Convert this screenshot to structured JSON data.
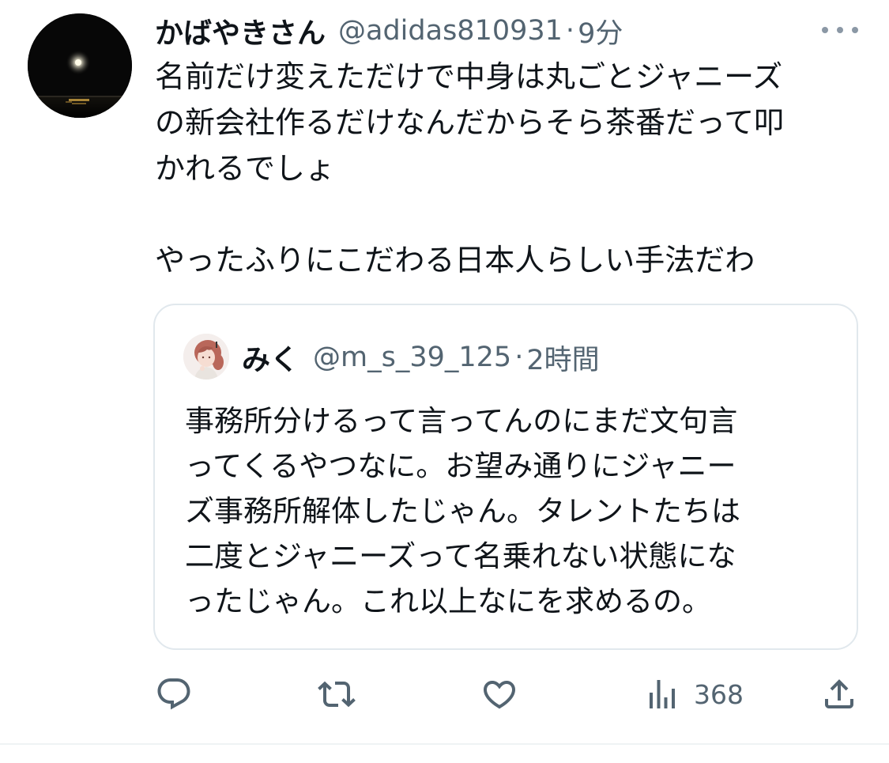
{
  "tweet": {
    "display_name": "かばやきさん",
    "handle": "@adidas810931",
    "separator": "·",
    "time": "9分",
    "avatar_icon": "moon-over-sea-avatar",
    "text_lines": [
      "名前だけ変えただけで中身は丸ごとジャニーズ",
      "の新会社作るだけなんだからそら茶番だって叩",
      "かれるでしょ",
      "",
      "やったふりにこだわる日本人らしい手法だわ"
    ]
  },
  "quoted_tweet": {
    "display_name": "みく",
    "handle": "@m_s_39_125",
    "separator": "·",
    "time": "2時間",
    "avatar_icon": "illustrated-girl-avatar",
    "text_lines": [
      "事務所分けるって言ってんのにまだ文句言",
      "ってくるやつなに。お望み通りにジャニー",
      "ズ事務所解体したじゃん。タレントたちは",
      "二度とジャニーズって名乗れない状態にな",
      "ったじゃん。これ以上なにを求めるの。"
    ]
  },
  "actions": {
    "reply_icon": "reply-icon",
    "retweet_icon": "retweet-icon",
    "like_icon": "heart-icon",
    "views_icon": "views-bar-icon",
    "views_count": "368",
    "share_icon": "share-icon"
  },
  "colors": {
    "text_primary": "#0f1419",
    "text_secondary": "#536471",
    "border": "#e1e8ed"
  }
}
